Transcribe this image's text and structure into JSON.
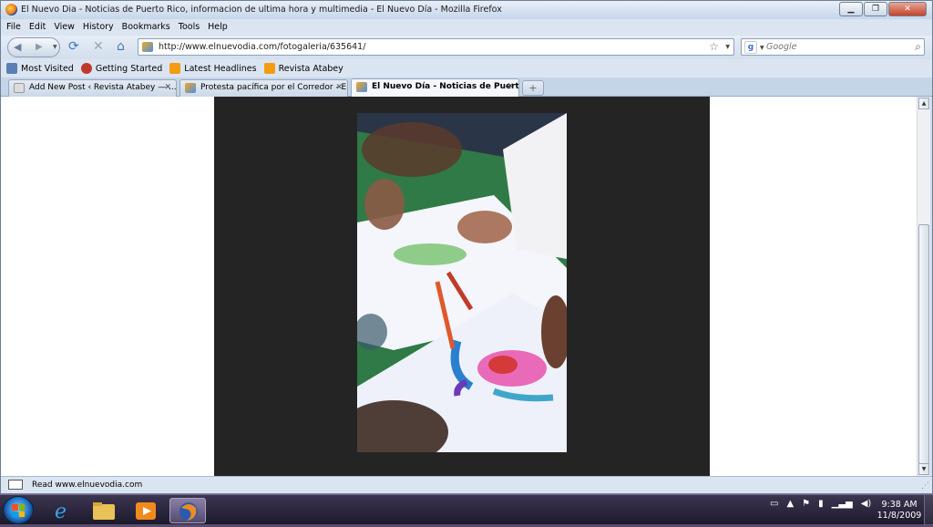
{
  "window": {
    "title": "El Nuevo Dia - Noticias de Puerto Rico, informacion de ultima hora y multimedia - El Nuevo Día - Mozilla Firefox"
  },
  "window_controls": {
    "minimize": "▁",
    "maximize": "❐",
    "close": "✕"
  },
  "menu": [
    "File",
    "Edit",
    "View",
    "History",
    "Bookmarks",
    "Tools",
    "Help"
  ],
  "nav": {
    "url": "http://www.elnuevodia.com/fotogaleria/635641/",
    "search_placeholder": "Google",
    "search_engine_letter": "g"
  },
  "bookmarks": [
    {
      "label": "Most Visited",
      "icon": "most-visited-icon",
      "color": "#5b7fb5"
    },
    {
      "label": "Getting Started",
      "icon": "firefox-leaf-icon",
      "color": "#c0392b"
    },
    {
      "label": "Latest Headlines",
      "icon": "rss-icon",
      "color": "#f39c12"
    },
    {
      "label": "Revista Atabey",
      "icon": "rss-icon",
      "color": "#f39c12"
    }
  ],
  "tabs": [
    {
      "label": "Add New Post ‹ Revista Atabey — ...",
      "active": false
    },
    {
      "label": "Protesta pacífica por el Corredor - E...",
      "active": false
    },
    {
      "label": "El Nuevo Día - Noticias de Puerto ...",
      "active": true
    }
  ],
  "status": {
    "text": "Read www.elnuevodia.com"
  },
  "clock": {
    "time": "9:38 AM",
    "date": "11/8/2009"
  },
  "colors": {
    "page_dark": "#242424",
    "chrome": "#dbe5f1",
    "taskbar": "#2a2540"
  }
}
